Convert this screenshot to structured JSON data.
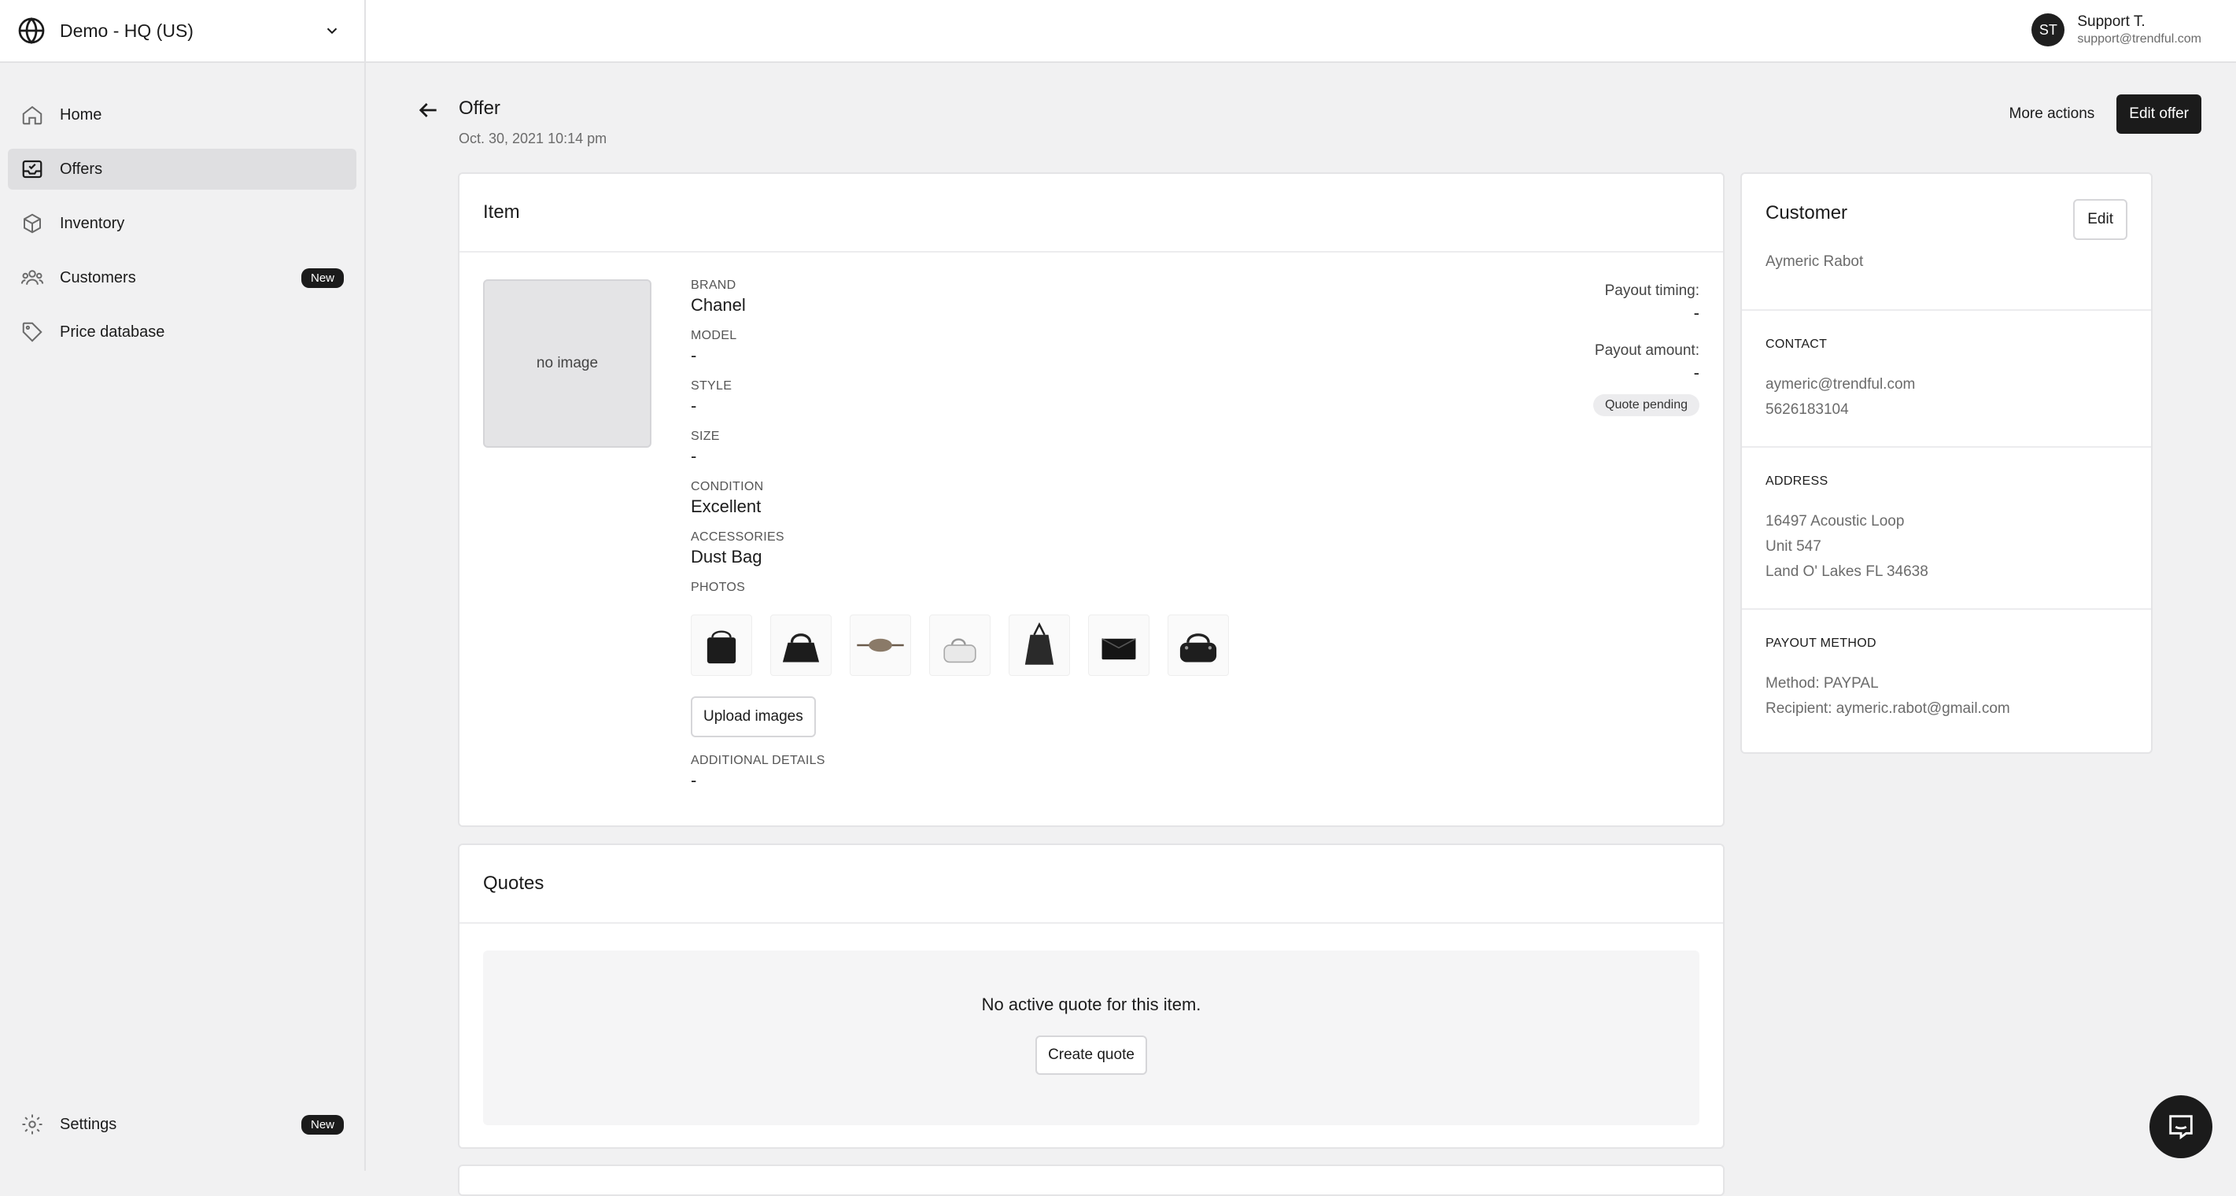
{
  "sidebar": {
    "org": "Demo - HQ (US)",
    "items": [
      {
        "label": "Home",
        "icon": "home-icon"
      },
      {
        "label": "Offers",
        "icon": "inbox-icon",
        "active": true
      },
      {
        "label": "Inventory",
        "icon": "box-icon"
      },
      {
        "label": "Customers",
        "icon": "users-icon",
        "badge": "New"
      },
      {
        "label": "Price database",
        "icon": "tag-icon"
      }
    ],
    "settings": {
      "label": "Settings",
      "badge": "New"
    }
  },
  "topbar": {
    "user_initials": "ST",
    "user_name": "Support T.",
    "user_email": "support@trendful.com"
  },
  "page": {
    "title": "Offer",
    "date": "Oct. 30, 2021 10:14 pm",
    "more_actions": "More actions",
    "edit_offer": "Edit offer"
  },
  "item": {
    "title": "Item",
    "no_image": "no image",
    "fields": {
      "brand_label": "BRAND",
      "brand": "Chanel",
      "model_label": "MODEL",
      "model": "-",
      "style_label": "STYLE",
      "style": "-",
      "size_label": "SIZE",
      "size": "-",
      "condition_label": "CONDITION",
      "condition": "Excellent",
      "accessories_label": "ACCESSORIES",
      "accessories": "Dust Bag",
      "photos_label": "PHOTOS",
      "additional_label": "ADDITIONAL DETAILS",
      "additional": "-"
    },
    "upload_label": "Upload images",
    "payout_timing_label": "Payout timing:",
    "payout_timing": "-",
    "payout_amount_label": "Payout amount:",
    "payout_amount": "-",
    "status": "Quote pending"
  },
  "quotes": {
    "title": "Quotes",
    "empty_message": "No active quote for this item.",
    "create_label": "Create quote"
  },
  "customer": {
    "title": "Customer",
    "edit_label": "Edit",
    "name": "Aymeric Rabot",
    "contact_label": "CONTACT",
    "email": "aymeric@trendful.com",
    "phone": "5626183104",
    "address_label": "ADDRESS",
    "address_line1": "16497 Acoustic Loop",
    "address_line2": "Unit 547",
    "address_line3": "Land O' Lakes FL 34638",
    "payout_label": "PAYOUT METHOD",
    "payout_method": "Method: PAYPAL",
    "payout_recipient": "Recipient: aymeric.rabot@gmail.com"
  }
}
